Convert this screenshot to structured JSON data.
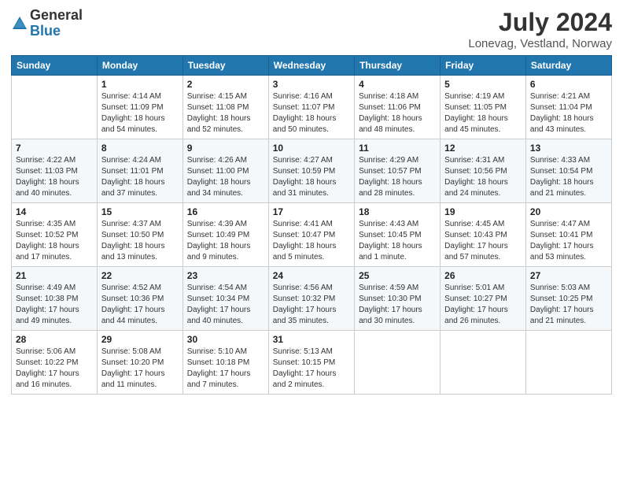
{
  "logo": {
    "general": "General",
    "blue": "Blue"
  },
  "header": {
    "month_year": "July 2024",
    "location": "Lonevag, Vestland, Norway"
  },
  "weekdays": [
    "Sunday",
    "Monday",
    "Tuesday",
    "Wednesday",
    "Thursday",
    "Friday",
    "Saturday"
  ],
  "weeks": [
    [
      {
        "day": "",
        "info": ""
      },
      {
        "day": "1",
        "info": "Sunrise: 4:14 AM\nSunset: 11:09 PM\nDaylight: 18 hours\nand 54 minutes."
      },
      {
        "day": "2",
        "info": "Sunrise: 4:15 AM\nSunset: 11:08 PM\nDaylight: 18 hours\nand 52 minutes."
      },
      {
        "day": "3",
        "info": "Sunrise: 4:16 AM\nSunset: 11:07 PM\nDaylight: 18 hours\nand 50 minutes."
      },
      {
        "day": "4",
        "info": "Sunrise: 4:18 AM\nSunset: 11:06 PM\nDaylight: 18 hours\nand 48 minutes."
      },
      {
        "day": "5",
        "info": "Sunrise: 4:19 AM\nSunset: 11:05 PM\nDaylight: 18 hours\nand 45 minutes."
      },
      {
        "day": "6",
        "info": "Sunrise: 4:21 AM\nSunset: 11:04 PM\nDaylight: 18 hours\nand 43 minutes."
      }
    ],
    [
      {
        "day": "7",
        "info": "Sunrise: 4:22 AM\nSunset: 11:03 PM\nDaylight: 18 hours\nand 40 minutes."
      },
      {
        "day": "8",
        "info": "Sunrise: 4:24 AM\nSunset: 11:01 PM\nDaylight: 18 hours\nand 37 minutes."
      },
      {
        "day": "9",
        "info": "Sunrise: 4:26 AM\nSunset: 11:00 PM\nDaylight: 18 hours\nand 34 minutes."
      },
      {
        "day": "10",
        "info": "Sunrise: 4:27 AM\nSunset: 10:59 PM\nDaylight: 18 hours\nand 31 minutes."
      },
      {
        "day": "11",
        "info": "Sunrise: 4:29 AM\nSunset: 10:57 PM\nDaylight: 18 hours\nand 28 minutes."
      },
      {
        "day": "12",
        "info": "Sunrise: 4:31 AM\nSunset: 10:56 PM\nDaylight: 18 hours\nand 24 minutes."
      },
      {
        "day": "13",
        "info": "Sunrise: 4:33 AM\nSunset: 10:54 PM\nDaylight: 18 hours\nand 21 minutes."
      }
    ],
    [
      {
        "day": "14",
        "info": "Sunrise: 4:35 AM\nSunset: 10:52 PM\nDaylight: 18 hours\nand 17 minutes."
      },
      {
        "day": "15",
        "info": "Sunrise: 4:37 AM\nSunset: 10:50 PM\nDaylight: 18 hours\nand 13 minutes."
      },
      {
        "day": "16",
        "info": "Sunrise: 4:39 AM\nSunset: 10:49 PM\nDaylight: 18 hours\nand 9 minutes."
      },
      {
        "day": "17",
        "info": "Sunrise: 4:41 AM\nSunset: 10:47 PM\nDaylight: 18 hours\nand 5 minutes."
      },
      {
        "day": "18",
        "info": "Sunrise: 4:43 AM\nSunset: 10:45 PM\nDaylight: 18 hours\nand 1 minute."
      },
      {
        "day": "19",
        "info": "Sunrise: 4:45 AM\nSunset: 10:43 PM\nDaylight: 17 hours\nand 57 minutes."
      },
      {
        "day": "20",
        "info": "Sunrise: 4:47 AM\nSunset: 10:41 PM\nDaylight: 17 hours\nand 53 minutes."
      }
    ],
    [
      {
        "day": "21",
        "info": "Sunrise: 4:49 AM\nSunset: 10:38 PM\nDaylight: 17 hours\nand 49 minutes."
      },
      {
        "day": "22",
        "info": "Sunrise: 4:52 AM\nSunset: 10:36 PM\nDaylight: 17 hours\nand 44 minutes."
      },
      {
        "day": "23",
        "info": "Sunrise: 4:54 AM\nSunset: 10:34 PM\nDaylight: 17 hours\nand 40 minutes."
      },
      {
        "day": "24",
        "info": "Sunrise: 4:56 AM\nSunset: 10:32 PM\nDaylight: 17 hours\nand 35 minutes."
      },
      {
        "day": "25",
        "info": "Sunrise: 4:59 AM\nSunset: 10:30 PM\nDaylight: 17 hours\nand 30 minutes."
      },
      {
        "day": "26",
        "info": "Sunrise: 5:01 AM\nSunset: 10:27 PM\nDaylight: 17 hours\nand 26 minutes."
      },
      {
        "day": "27",
        "info": "Sunrise: 5:03 AM\nSunset: 10:25 PM\nDaylight: 17 hours\nand 21 minutes."
      }
    ],
    [
      {
        "day": "28",
        "info": "Sunrise: 5:06 AM\nSunset: 10:22 PM\nDaylight: 17 hours\nand 16 minutes."
      },
      {
        "day": "29",
        "info": "Sunrise: 5:08 AM\nSunset: 10:20 PM\nDaylight: 17 hours\nand 11 minutes."
      },
      {
        "day": "30",
        "info": "Sunrise: 5:10 AM\nSunset: 10:18 PM\nDaylight: 17 hours\nand 7 minutes."
      },
      {
        "day": "31",
        "info": "Sunrise: 5:13 AM\nSunset: 10:15 PM\nDaylight: 17 hours\nand 2 minutes."
      },
      {
        "day": "",
        "info": ""
      },
      {
        "day": "",
        "info": ""
      },
      {
        "day": "",
        "info": ""
      }
    ]
  ]
}
